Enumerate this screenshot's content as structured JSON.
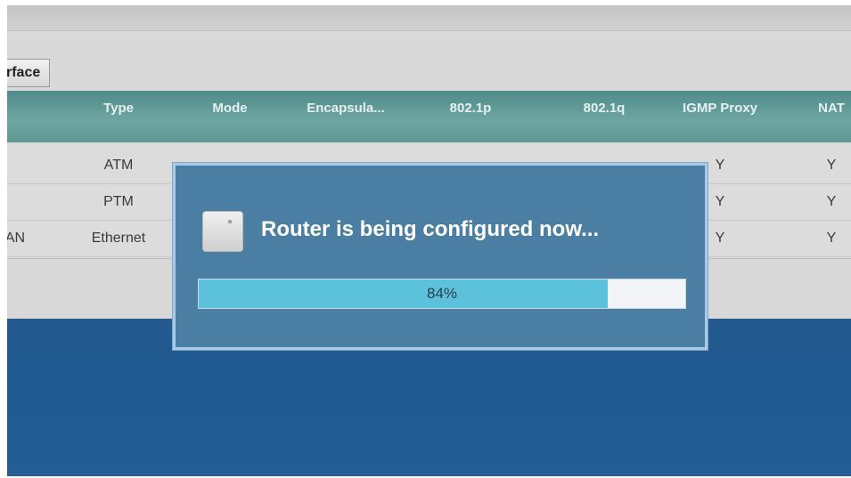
{
  "interface_tab": {
    "label": "rface"
  },
  "table": {
    "headers": [
      "",
      "Type",
      "Mode",
      "Encapsula...",
      "802.1p",
      "802.1q",
      "IGMP Proxy",
      "NAT"
    ],
    "rows": [
      {
        "name": "",
        "type": "ATM",
        "igmp": "Y",
        "nat": "Y"
      },
      {
        "name": "",
        "type": "PTM",
        "igmp": "Y",
        "nat": "Y"
      },
      {
        "name": "AN",
        "type": "Ethernet",
        "igmp": "Y",
        "nat": "Y"
      }
    ]
  },
  "dialog": {
    "message": "Router is being configured now...",
    "icon": "router-device-icon",
    "progress_percent": 84,
    "progress_label": "84%"
  },
  "colors": {
    "header_teal": "#5f9894",
    "modal_blue": "#4a7ea2",
    "progress_fill": "#5cc2dc",
    "background_blue": "#1f5a92"
  }
}
